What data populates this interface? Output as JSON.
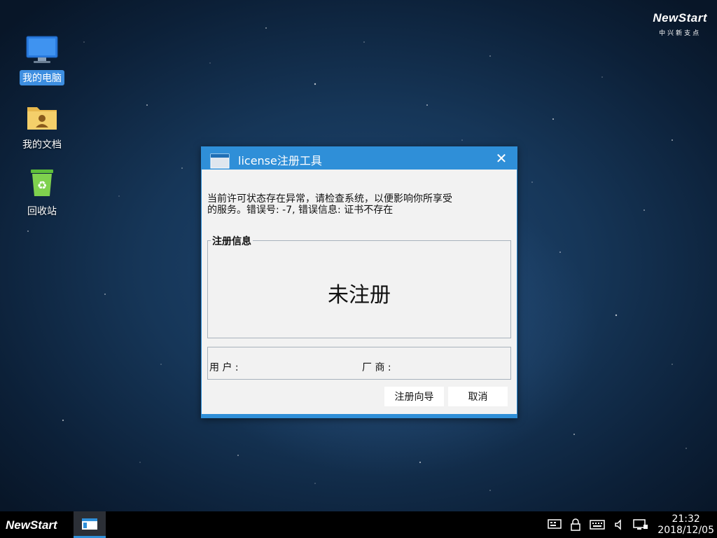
{
  "brand": {
    "logo": "NewStart",
    "subtitle": "中兴新支点"
  },
  "desktop": {
    "icons": [
      {
        "label": "我的电脑"
      },
      {
        "label": "我的文档"
      },
      {
        "label": "回收站"
      }
    ]
  },
  "dialog": {
    "title": "license注册工具",
    "message_line1": "当前许可状态存在异常，请检查系统，以便影响你所享受",
    "message_line2": "的服务。错误号: -7, 错误信息: 证书不存在",
    "group_title": "注册信息",
    "status": "未注册",
    "user_label": "用 户 :",
    "vendor_label": "厂 商 :",
    "wizard_button": "注册向导",
    "cancel_button": "取消"
  },
  "taskbar": {
    "start_label": "NewStart",
    "time": "21:32",
    "date": "2018/12/05"
  },
  "colors": {
    "accent": "#2f8fd8",
    "selection": "#3d8ee0",
    "taskbar": "#000000"
  }
}
